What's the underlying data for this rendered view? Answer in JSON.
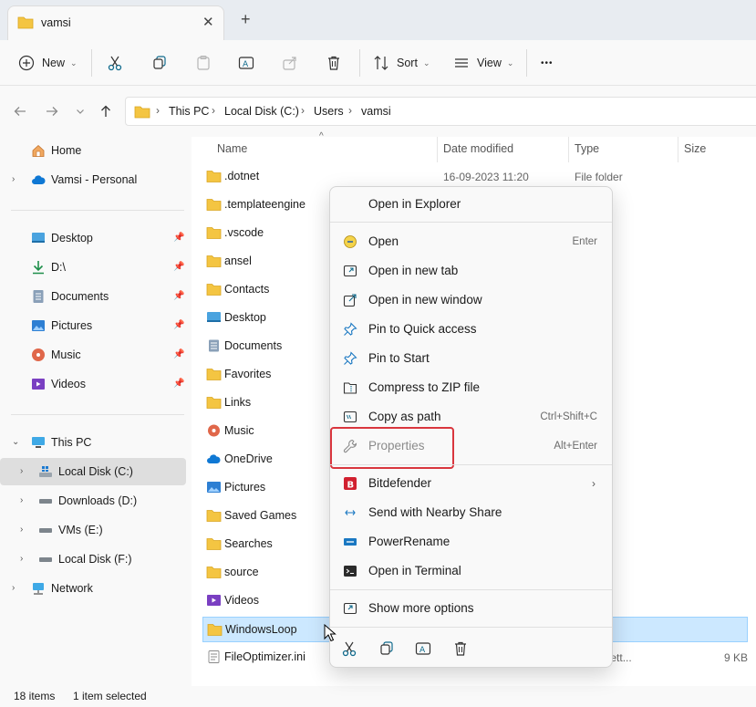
{
  "window": {
    "tab_title": "vamsi",
    "close_glyph": "✕",
    "new_tab_glyph": "+"
  },
  "toolbar": {
    "new_label": "New",
    "sort_label": "Sort",
    "view_label": "View",
    "more_glyph": "•••"
  },
  "breadcrumb": [
    "This PC",
    "Local Disk (C:)",
    "Users",
    "vamsi"
  ],
  "nav": {
    "home": "Home",
    "onedrive": "Vamsi - Personal",
    "quick": [
      {
        "label": "Desktop",
        "icon": "desktop-icon"
      },
      {
        "label": "D:\\",
        "icon": "download-icon"
      },
      {
        "label": "Documents",
        "icon": "documents-icon"
      },
      {
        "label": "Pictures",
        "icon": "pictures-icon"
      },
      {
        "label": "Music",
        "icon": "music-icon"
      },
      {
        "label": "Videos",
        "icon": "videos-icon"
      }
    ],
    "this_pc": "This PC",
    "drives": [
      "Local Disk (C:)",
      "Downloads (D:)",
      "VMs (E:)",
      "Local Disk (F:)"
    ],
    "network": "Network"
  },
  "columns": {
    "name": "Name",
    "date": "Date modified",
    "type": "Type",
    "size": "Size"
  },
  "files": [
    {
      "name": ".dotnet",
      "date": "16-09-2023 11:20",
      "type": "File folder",
      "size": ""
    },
    {
      "name": ".templateengine",
      "date": "",
      "type": "er",
      "size": ""
    },
    {
      "name": ".vscode",
      "date": "",
      "type": "er",
      "size": ""
    },
    {
      "name": "ansel",
      "date": "",
      "type": "er",
      "size": ""
    },
    {
      "name": "Contacts",
      "date": "",
      "type": "er",
      "size": ""
    },
    {
      "name": "Desktop",
      "date": "",
      "type": "er",
      "size": ""
    },
    {
      "name": "Documents",
      "date": "",
      "type": "er",
      "size": ""
    },
    {
      "name": "Favorites",
      "date": "",
      "type": "er",
      "size": ""
    },
    {
      "name": "Links",
      "date": "",
      "type": "er",
      "size": ""
    },
    {
      "name": "Music",
      "date": "",
      "type": "er",
      "size": ""
    },
    {
      "name": "OneDrive",
      "date": "",
      "type": "er",
      "size": ""
    },
    {
      "name": "Pictures",
      "date": "",
      "type": "er",
      "size": ""
    },
    {
      "name": "Saved Games",
      "date": "",
      "type": "er",
      "size": ""
    },
    {
      "name": "Searches",
      "date": "",
      "type": "er",
      "size": ""
    },
    {
      "name": "source",
      "date": "",
      "type": "er",
      "size": ""
    },
    {
      "name": "Videos",
      "date": "",
      "type": "er",
      "size": ""
    },
    {
      "name": "WindowsLoop",
      "date": "",
      "type": "er",
      "size": ""
    },
    {
      "name": "FileOptimizer.ini",
      "date": "",
      "type": "ration sett...",
      "size": "9 KB"
    }
  ],
  "context_menu": {
    "open_in_explorer": "Open in Explorer",
    "open": "Open",
    "open_shortcut": "Enter",
    "open_new_tab": "Open in new tab",
    "open_new_window": "Open in new window",
    "pin_quick": "Pin to Quick access",
    "pin_start": "Pin to Start",
    "compress": "Compress to ZIP file",
    "copy_path": "Copy as path",
    "copy_path_shortcut": "Ctrl+Shift+C",
    "properties": "Properties",
    "properties_shortcut": "Alt+Enter",
    "bitdefender": "Bitdefender",
    "nearby_share": "Send with Nearby Share",
    "powerrename": "PowerRename",
    "open_terminal": "Open in Terminal",
    "more_options": "Show more options"
  },
  "status": {
    "items": "18 items",
    "selected": "1 item selected"
  },
  "colors": {
    "accent": "#0067c0",
    "highlight": "#d9363e",
    "folder": "#f4c542",
    "selection": "#cce8ff"
  }
}
